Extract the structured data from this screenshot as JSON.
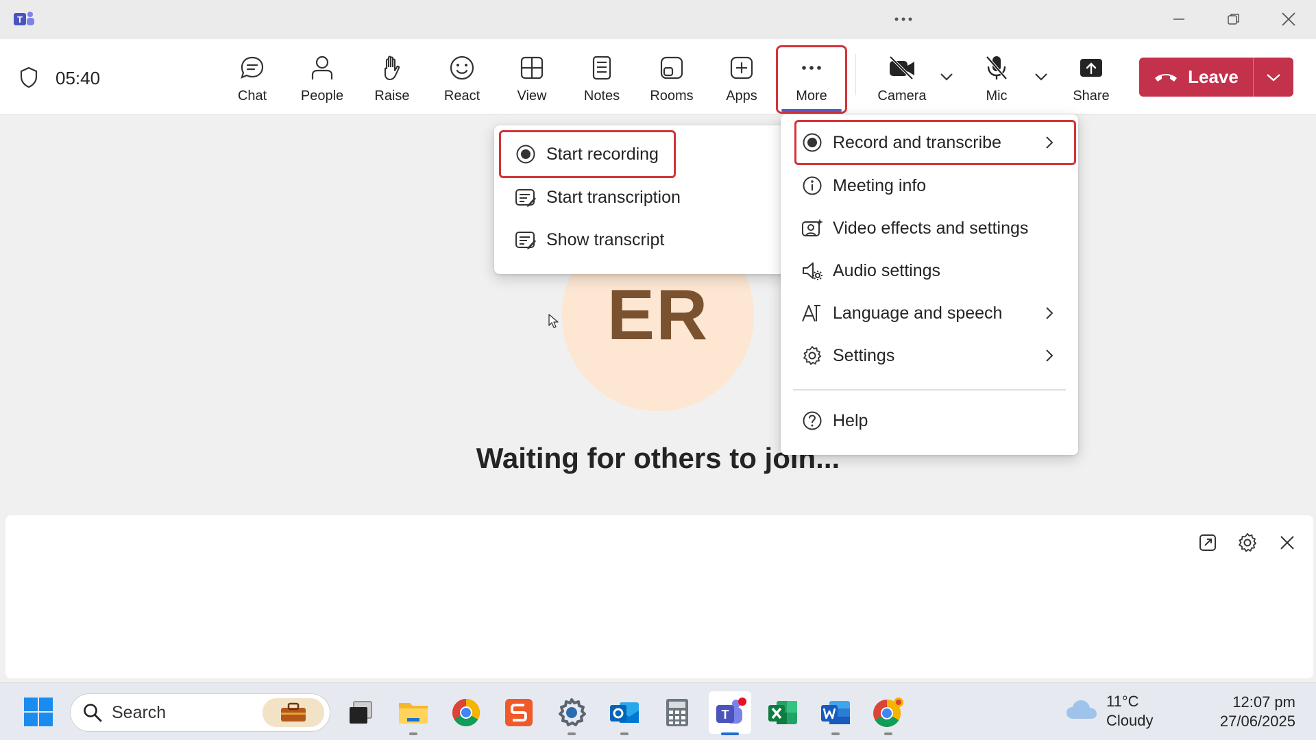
{
  "window": {
    "app": "Microsoft Teams",
    "title_more_icon": "ellipsis-icon"
  },
  "toolbar": {
    "timer": "05:40",
    "items": [
      {
        "label": "Chat",
        "icon": "chat-icon"
      },
      {
        "label": "People",
        "icon": "person-icon"
      },
      {
        "label": "Raise",
        "icon": "raise-hand-icon"
      },
      {
        "label": "React",
        "icon": "smiley-icon"
      },
      {
        "label": "View",
        "icon": "grid-icon"
      },
      {
        "label": "Notes",
        "icon": "notes-icon"
      },
      {
        "label": "Rooms",
        "icon": "rooms-icon"
      },
      {
        "label": "Apps",
        "icon": "plus-square-icon"
      },
      {
        "label": "More",
        "icon": "ellipsis-icon"
      },
      {
        "label": "Camera",
        "icon": "camera-off-icon"
      },
      {
        "label": "Mic",
        "icon": "mic-off-icon"
      },
      {
        "label": "Share",
        "icon": "share-icon"
      }
    ],
    "leave_label": "Leave",
    "leave_color": "#c4314b",
    "highlight_color": "#d13438",
    "active_underline_color": "#5b5fc7"
  },
  "stage": {
    "avatar_initials": "ER",
    "avatar_bg": "#fde6d2",
    "waiting_text": "Waiting for others to join..."
  },
  "record_submenu": {
    "items": [
      {
        "label": "Start recording",
        "icon": "record-icon",
        "highlighted": true
      },
      {
        "label": "Start transcription",
        "icon": "transcript-icon"
      },
      {
        "label": "Show transcript",
        "icon": "transcript-icon"
      }
    ]
  },
  "more_menu": {
    "items": [
      {
        "label": "Record and transcribe",
        "icon": "record-icon",
        "submenu": true,
        "highlighted": true
      },
      {
        "label": "Meeting info",
        "icon": "info-icon"
      },
      {
        "label": "Video effects and settings",
        "icon": "video-effects-icon"
      },
      {
        "label": "Audio settings",
        "icon": "audio-settings-icon"
      },
      {
        "label": "Language and speech",
        "icon": "language-icon",
        "submenu": true
      },
      {
        "label": "Settings",
        "icon": "gear-icon",
        "submenu": true
      },
      {
        "label": "Help",
        "icon": "help-icon"
      }
    ]
  },
  "caption_panel": {
    "buttons": [
      "pop-out-icon",
      "gear-icon",
      "close-icon"
    ]
  },
  "taskbar": {
    "search_label": "Search",
    "apps": [
      "task-view-icon",
      "file-explorer-icon",
      "chrome-icon",
      "snagit-icon",
      "settings-icon",
      "outlook-icon",
      "calculator-icon",
      "teams-icon",
      "excel-icon",
      "word-icon",
      "chrome-icon"
    ],
    "weather_temp": "11°C",
    "weather_condition": "Cloudy",
    "time": "12:07 pm",
    "date": "27/06/2025"
  }
}
